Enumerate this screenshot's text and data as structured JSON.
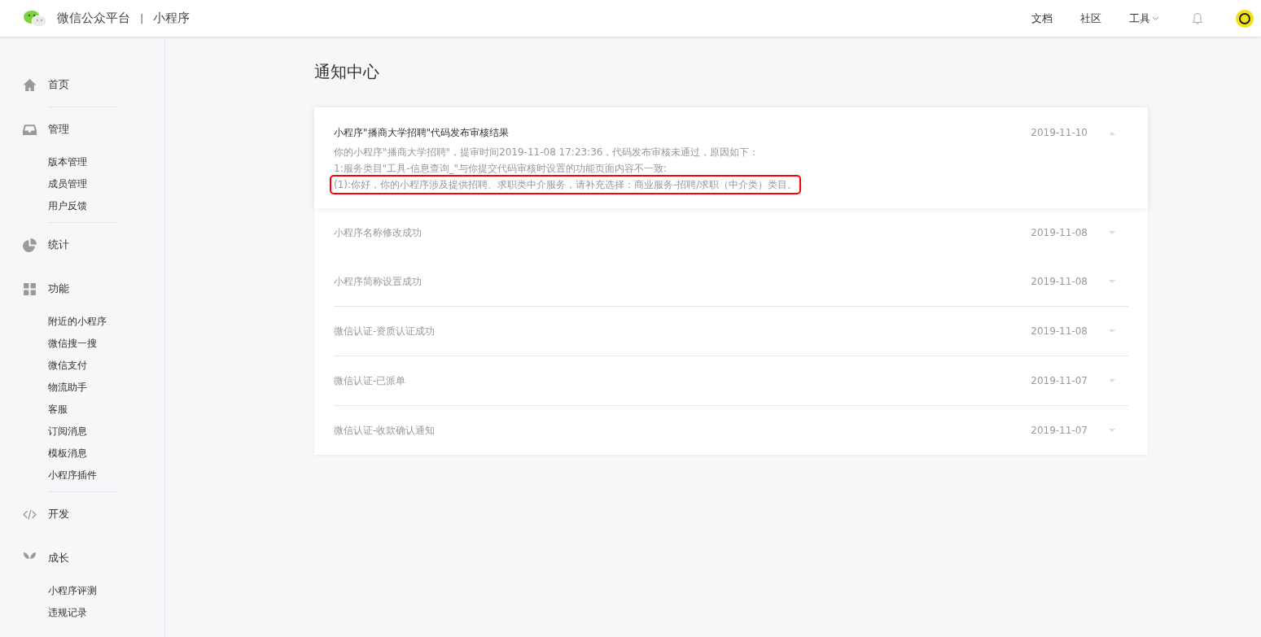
{
  "header": {
    "brand": "微信公众平台",
    "divider": "|",
    "product": "小程序",
    "nav": [
      {
        "label": "文档",
        "dropdown": false
      },
      {
        "label": "社区",
        "dropdown": false
      },
      {
        "label": "工具",
        "dropdown": true
      }
    ]
  },
  "sidebar": {
    "sections": [
      {
        "label": "首页",
        "separator_after": true
      },
      {
        "label": "管理",
        "separator_after": true,
        "children": [
          "版本管理",
          "成员管理",
          "用户反馈"
        ]
      },
      {
        "label": "统计",
        "separator_after": false
      },
      {
        "label": "功能",
        "separator_after": true,
        "children": [
          "附近的小程序",
          "微信搜一搜",
          "微信支付",
          "物流助手",
          "客服",
          "订阅消息",
          "模板消息",
          "小程序插件"
        ]
      },
      {
        "label": "开发",
        "separator_after": false
      },
      {
        "label": "成长",
        "children": [
          "小程序评测",
          "违规记录"
        ]
      }
    ]
  },
  "page": {
    "title": "通知中心"
  },
  "notifications": [
    {
      "title": "小程序\"播商大学招聘\"代码发布审核结果",
      "date": "2019-11-10",
      "expanded": true,
      "body": [
        {
          "text": "你的小程序\"播商大学招聘\"，提审时间2019-11-08 17:23:36，代码发布审核未通过，原因如下：",
          "highlighted": false
        },
        {
          "text": "1:服务类目\"工具-信息查询_\"与你提交代码审核时设置的功能页面内容不一致:",
          "highlighted": false
        },
        {
          "text": "(1):你好，你的小程序涉及提供招聘、求职类中介服务，请补充选择：商业服务-招聘/求职（中介类）类目。",
          "highlighted": true
        }
      ]
    },
    {
      "title": "小程序名称修改成功",
      "date": "2019-11-08",
      "expanded": false
    },
    {
      "title": "小程序简称设置成功",
      "date": "2019-11-08",
      "expanded": false
    },
    {
      "title": "微信认证-资质认证成功",
      "date": "2019-11-08",
      "expanded": false
    },
    {
      "title": "微信认证-已派单",
      "date": "2019-11-07",
      "expanded": false
    },
    {
      "title": "微信认证-收款确认通知",
      "date": "2019-11-07",
      "expanded": false
    }
  ]
}
